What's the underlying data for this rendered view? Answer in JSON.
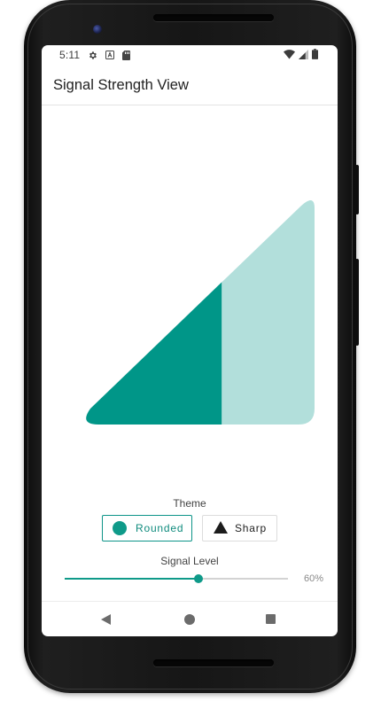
{
  "status_bar": {
    "time": "5:11",
    "left_icons": [
      "gear-icon",
      "font-a-icon",
      "sd-card-icon"
    ],
    "right_icons": [
      "wifi-icon",
      "cell-signal-icon",
      "battery-icon"
    ]
  },
  "app_bar": {
    "title": "Signal Strength View"
  },
  "signal_view": {
    "level": 0.6,
    "filled_color": "#009688",
    "empty_color": "#B2DFDB",
    "theme": "Rounded"
  },
  "theme_section": {
    "label": "Theme",
    "options": [
      {
        "label": "Rounded",
        "icon": "circle-icon",
        "selected": true
      },
      {
        "label": "Sharp",
        "icon": "triangle-icon",
        "selected": false
      }
    ]
  },
  "signal_level": {
    "label": "Signal Level",
    "value": 0.6,
    "value_text": "60%"
  },
  "nav_bar": {
    "buttons": [
      "back-icon",
      "home-icon",
      "recents-icon"
    ]
  },
  "colors": {
    "accent": "#0F9A89"
  }
}
